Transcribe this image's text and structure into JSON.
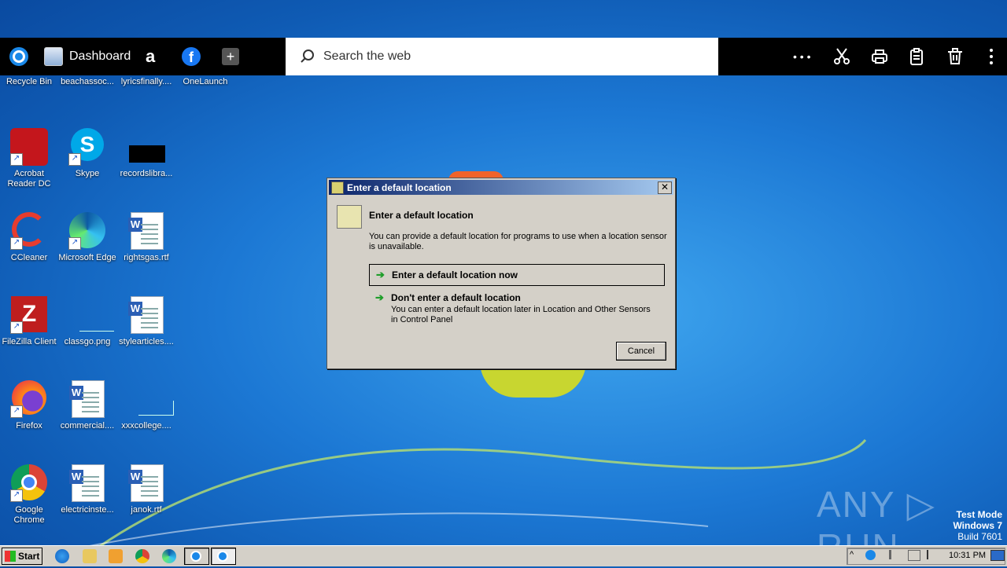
{
  "topbar": {
    "dashboard_label": "Dashboard",
    "search_placeholder": "Search the web",
    "more_label": "• • •"
  },
  "desktop": {
    "icons": [
      {
        "label": "Recycle Bin"
      },
      {
        "label": "beachassoc..."
      },
      {
        "label": "lyricsfinally...."
      },
      {
        "label": "OneLaunch"
      },
      {
        "label": "Acrobat Reader DC"
      },
      {
        "label": "Skype"
      },
      {
        "label": "recordslibra..."
      },
      {
        "label": "CCleaner"
      },
      {
        "label": "Microsoft Edge"
      },
      {
        "label": "rightsgas.rtf"
      },
      {
        "label": "FileZilla Client"
      },
      {
        "label": "classgo.png"
      },
      {
        "label": "stylearticles...."
      },
      {
        "label": "Firefox"
      },
      {
        "label": "commercial...."
      },
      {
        "label": "xxxcollege...."
      },
      {
        "label": "Google Chrome"
      },
      {
        "label": "electricinste..."
      },
      {
        "label": "janok.rtf"
      }
    ]
  },
  "dialog": {
    "title": "Enter a default location",
    "heading": "Enter a default location",
    "description": "You can provide a default location for programs to use when a location sensor is unavailable.",
    "option1_label": "Enter a default location now",
    "option2_label": "Don't enter a default location",
    "option2_desc": "You can enter a default location later in Location and Other Sensors in Control Panel",
    "cancel_label": "Cancel",
    "close_glyph": "✕"
  },
  "watermark": {
    "brand": "ANY ▷ RUN",
    "test_mode": "Test Mode",
    "os": "Windows 7",
    "build": "Build 7601"
  },
  "taskbar": {
    "start_label": "Start",
    "clock": "10:31 PM"
  }
}
